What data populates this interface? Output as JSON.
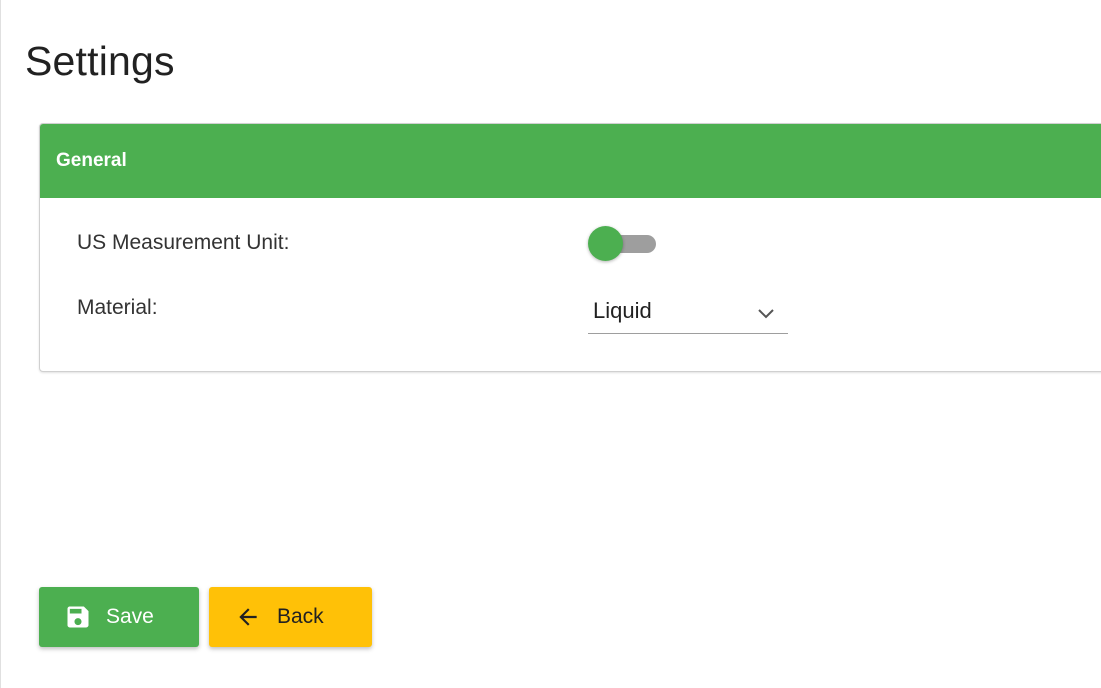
{
  "page": {
    "title": "Settings"
  },
  "general_card": {
    "header": "General",
    "us_measurement_unit": {
      "label": "US Measurement Unit:",
      "enabled": false
    },
    "material": {
      "label": "Material:",
      "value": "Liquid"
    }
  },
  "actions": {
    "save_label": "Save",
    "back_label": "Back"
  },
  "icons": {
    "save": "floppy-disk-icon",
    "back": "arrow-left-icon",
    "dropdown": "chevron-down-icon"
  },
  "colors": {
    "primary_green": "#4caf50",
    "accent_amber": "#ffc107",
    "toggle_track_off": "#9e9e9e"
  }
}
